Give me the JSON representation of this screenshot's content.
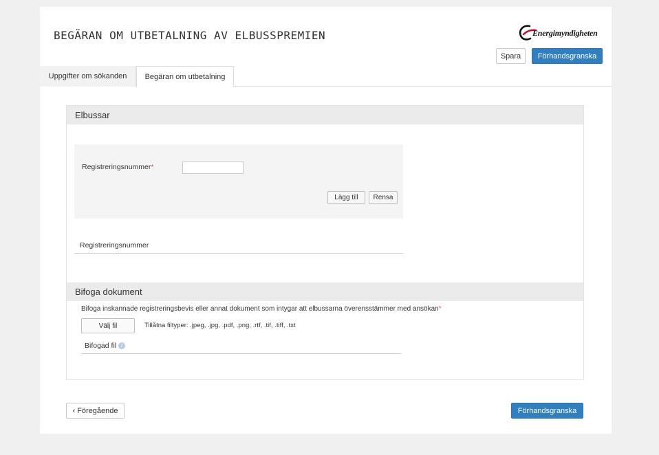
{
  "header": {
    "title": "BEGÄRAN OM UTBETALNING AV ELBUSSPREMIEN",
    "logo_text": "Energimyndigheten",
    "save_label": "Spara",
    "preview_label": "Förhandsgranska"
  },
  "tabs": [
    {
      "label": "Uppgifter om sökanden"
    },
    {
      "label": "Begäran om utbetalning"
    }
  ],
  "elbussar": {
    "heading": "Elbussar",
    "reg_label": "Registreringsnummer",
    "required_mark": "*",
    "reg_value": "",
    "add_label": "Lägg till",
    "clear_label": "Rensa",
    "list_header": "Registreringsnummer"
  },
  "bifoga": {
    "heading": "Bifoga dokument",
    "instruction": "Bifoga inskannade registreringsbevis eller annat dokument som intygar att elbussarna överensstämmer med ansökan",
    "required_mark": "*",
    "choose_file_label": "Välj fil",
    "allowed_types": "Tillåtna filtyper: .jpeg, .jpg, .pdf, .png, .rtf, .tif, .tiff, .txt",
    "attached_label": "Bifogad fil",
    "info_icon": "i"
  },
  "footer": {
    "prev_label": "‹ Föregående",
    "preview_label": "Förhandsgranska"
  },
  "colors": {
    "primary": "#2f7fc1",
    "required": "#d9534f",
    "logo_red": "#c8102e"
  }
}
